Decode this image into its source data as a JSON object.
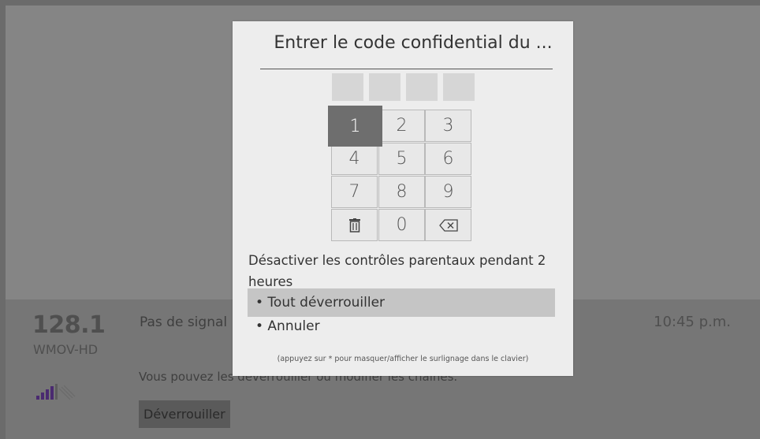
{
  "channel": {
    "number": "128.1",
    "name": "WMOV-HD",
    "signal_icon": "signal-strength-icon"
  },
  "status": {
    "no_signal": "Pas de signal",
    "time": "10:45 p.m.",
    "message": "Vous pouvez les déverrouiller ou modifier les chaînes.",
    "unlock_button": "Déverrouiller"
  },
  "dialog": {
    "title": "Entrer le code confidential du ...",
    "pin_length": 4,
    "keys": [
      "1",
      "2",
      "3",
      "4",
      "5",
      "6",
      "7",
      "8",
      "9",
      "trash-icon",
      "0",
      "backspace-icon"
    ],
    "key_labels": {
      "k1": "1",
      "k2": "2",
      "k3": "3",
      "k4": "4",
      "k5": "5",
      "k6": "6",
      "k7": "7",
      "k8": "8",
      "k9": "9",
      "k0": "0"
    },
    "selected_key": "1",
    "disable_text": "Désactiver les contrôles parentaux pendant 2 heures",
    "options": {
      "unlock_all": "• Tout déverrouiller",
      "cancel": "• Annuler"
    },
    "highlighted_option": "unlock_all",
    "hint": "(appuyez sur * pour masquer/afficher le surlignage dans le clavier)"
  },
  "colors": {
    "dialog_bg": "#ededed",
    "selected_key": "#6e6e6e",
    "signal_bars": "#4a2a70"
  }
}
